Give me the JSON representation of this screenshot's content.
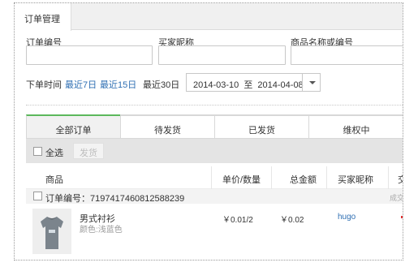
{
  "header": {
    "tab_label": "订单管理"
  },
  "filters": {
    "order_no_label": "订单编号",
    "order_no_value": "",
    "buyer_nick_label": "买家昵称",
    "buyer_nick_value": "",
    "product_label": "商品名称或编号",
    "product_value": "",
    "time_label": "下单时间",
    "quick_ranges": [
      "最近7日",
      "最近15日",
      "最近30日"
    ],
    "active_range": "最近30日",
    "date_from": "2014-03-10",
    "date_to_word": "至",
    "date_to": "2014-04-08"
  },
  "status_tabs": [
    {
      "label": "全部订单",
      "active": true
    },
    {
      "label": "待发货",
      "active": false
    },
    {
      "label": "已发货",
      "active": false
    },
    {
      "label": "维权中",
      "active": false
    }
  ],
  "toolbar": {
    "select_all_label": "全选",
    "ship_label": "发货"
  },
  "table": {
    "columns": [
      "商品",
      "单价/数量",
      "总金额",
      "买家昵称",
      "交"
    ],
    "order": {
      "id_text": "订单编号：7197417460812588239",
      "extra_text": "成交",
      "item": {
        "name": "男式衬衫",
        "color": "颜色:浅蓝色",
        "price_qty": "￥0.01/2",
        "total": "￥0.02",
        "buyer": "hugo"
      }
    }
  },
  "colors": {
    "link": "#2f6fb3",
    "active_tab_accent": "#5cb85c",
    "toolbar_bg": "#e4e4e4"
  },
  "icons": {
    "date_dropdown": "caret-down-icon",
    "thumbnail": "tshirt-image"
  }
}
